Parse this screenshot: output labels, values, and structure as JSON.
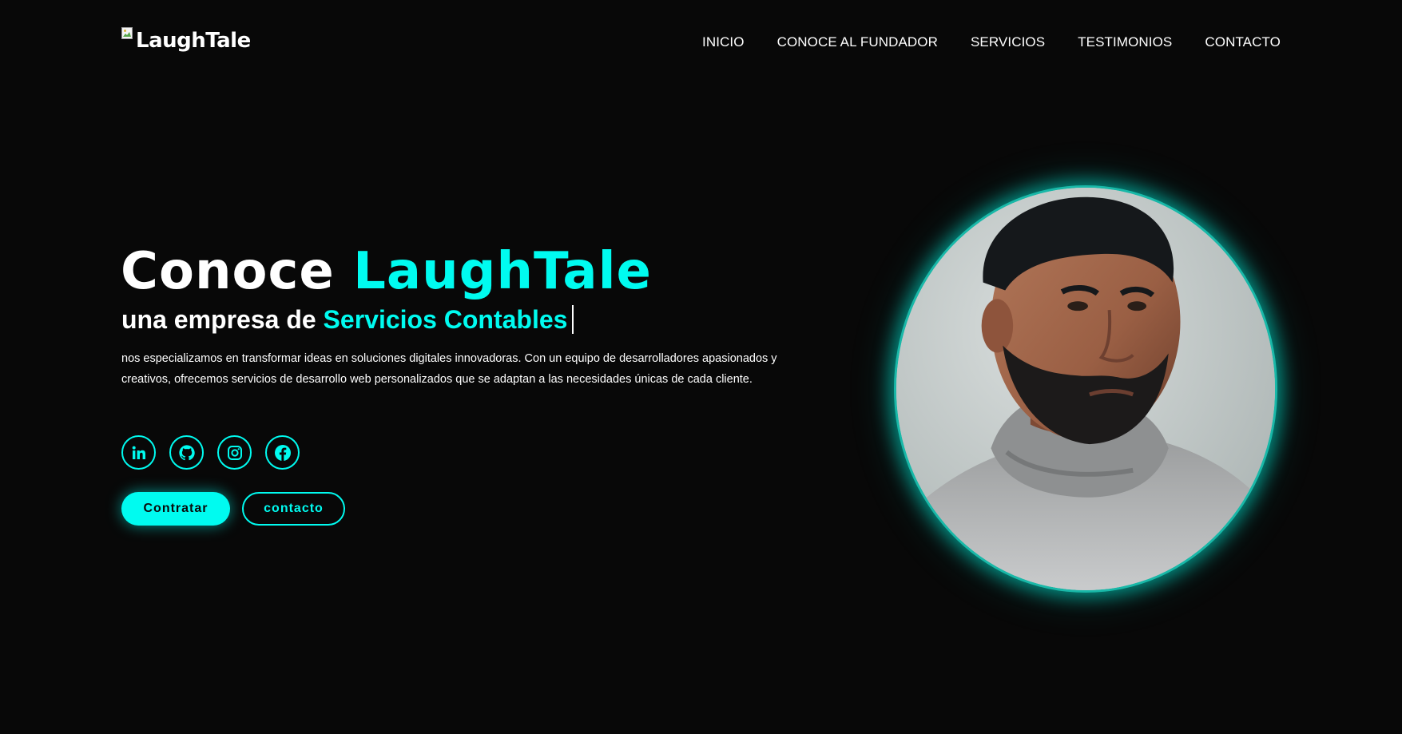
{
  "header": {
    "logo_alt": "LaughTale",
    "nav": [
      "INICIO",
      "CONOCE AL FUNDADOR",
      "SERVICIOS",
      "TESTIMONIOS",
      "CONTACTO"
    ]
  },
  "hero": {
    "title_prefix": "Conoce",
    "title_brand": "LaughTale",
    "subtitle_prefix": "una empresa de",
    "subtitle_typed": "Servicios Contables",
    "description": "nos especializamos en transformar ideas en soluciones digitales innovadoras. Con un equipo de desarrolladores apasionados y creativos, ofrecemos servicios de desarrollo web personalizados que se adaptan a las necesidades únicas de cada cliente.",
    "socials": [
      "linkedin-icon",
      "github-icon",
      "instagram-icon",
      "facebook-icon"
    ],
    "primary_button": "Contratar",
    "secondary_button": "contacto"
  },
  "colors": {
    "background": "#080808",
    "accent": "#00fbf0",
    "text": "#ffffff"
  }
}
